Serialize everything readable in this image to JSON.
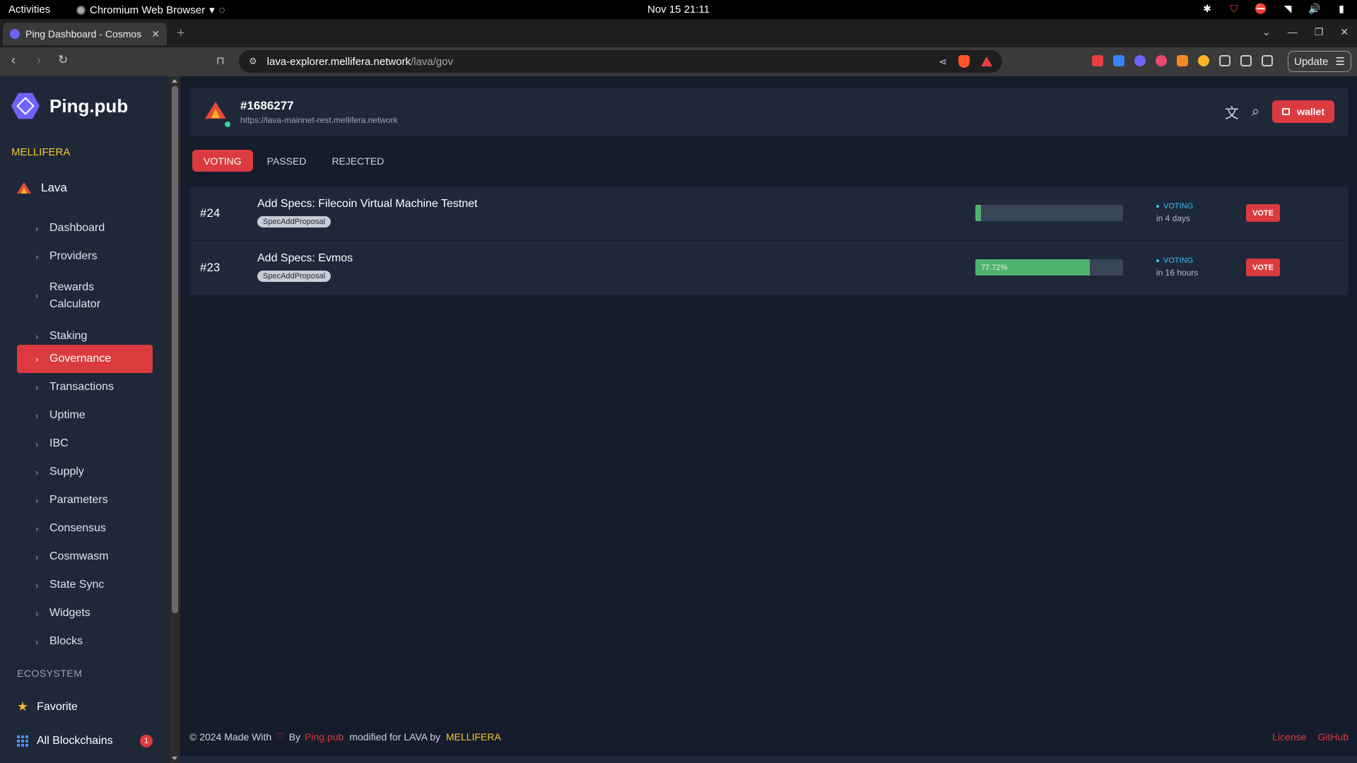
{
  "os": {
    "activities": "Activities",
    "app_name": "Chromium Web Browser",
    "clock": "Nov 15  21:11"
  },
  "browser": {
    "tab_title": "Ping Dashboard - Cosmos",
    "url_host": "lava-explorer.mellifera.network",
    "url_path": "/lava/gov",
    "update_label": "Update"
  },
  "sidebar": {
    "brand": "Ping.pub",
    "org": "MELLIFERA",
    "chain": "Lava",
    "items": [
      {
        "label": "Dashboard",
        "active": false
      },
      {
        "label": "Providers",
        "active": false
      },
      {
        "label": "Rewards Calculator",
        "active": false
      },
      {
        "label": "Staking",
        "active": false
      },
      {
        "label": "Governance",
        "active": true
      },
      {
        "label": "Transactions",
        "active": false
      },
      {
        "label": "Uptime",
        "active": false
      },
      {
        "label": "IBC",
        "active": false
      },
      {
        "label": "Supply",
        "active": false
      },
      {
        "label": "Parameters",
        "active": false
      },
      {
        "label": "Consensus",
        "active": false
      },
      {
        "label": "Cosmwasm",
        "active": false
      },
      {
        "label": "State Sync",
        "active": false
      },
      {
        "label": "Widgets",
        "active": false
      },
      {
        "label": "Blocks",
        "active": false
      }
    ],
    "ecosystem_label": "ECOSYSTEM",
    "favorite_label": "Favorite",
    "all_blockchains_label": "All Blockchains",
    "all_blockchains_badge": "1"
  },
  "header": {
    "block_height": "#1686277",
    "endpoint": "https://lava-mainnet-rest.mellifera.network",
    "wallet_label": "wallet"
  },
  "gov_tabs": [
    {
      "label": "VOTING",
      "active": true
    },
    {
      "label": "PASSED",
      "active": false
    },
    {
      "label": "REJECTED",
      "active": false
    }
  ],
  "proposals": [
    {
      "id": "#24",
      "title": "Add Specs: Filecoin Virtual Machine Testnet",
      "type": "SpecAddProposal",
      "progress_pct": 4,
      "progress_label": "",
      "status": "VOTING",
      "time_left": "in 4 days",
      "vote_label": "VOTE"
    },
    {
      "id": "#23",
      "title": "Add Specs: Evmos",
      "type": "SpecAddProposal",
      "progress_pct": 77.72,
      "progress_label": "77.72%",
      "status": "VOTING",
      "time_left": "in 16 hours",
      "vote_label": "VOTE"
    }
  ],
  "footer": {
    "copyright": "© 2024  Made With",
    "by": "By",
    "pingpub": "Ping.pub",
    "modified": "modified for LAVA by",
    "mellifera": "MELLIFERA",
    "license": "License",
    "github": "GitHub"
  },
  "colors": {
    "accent": "#db3b3f",
    "panel": "#1e2839",
    "background": "#151c2c",
    "progress": "#4fb36e",
    "status": "#3abff8",
    "org": "#f7c925"
  }
}
